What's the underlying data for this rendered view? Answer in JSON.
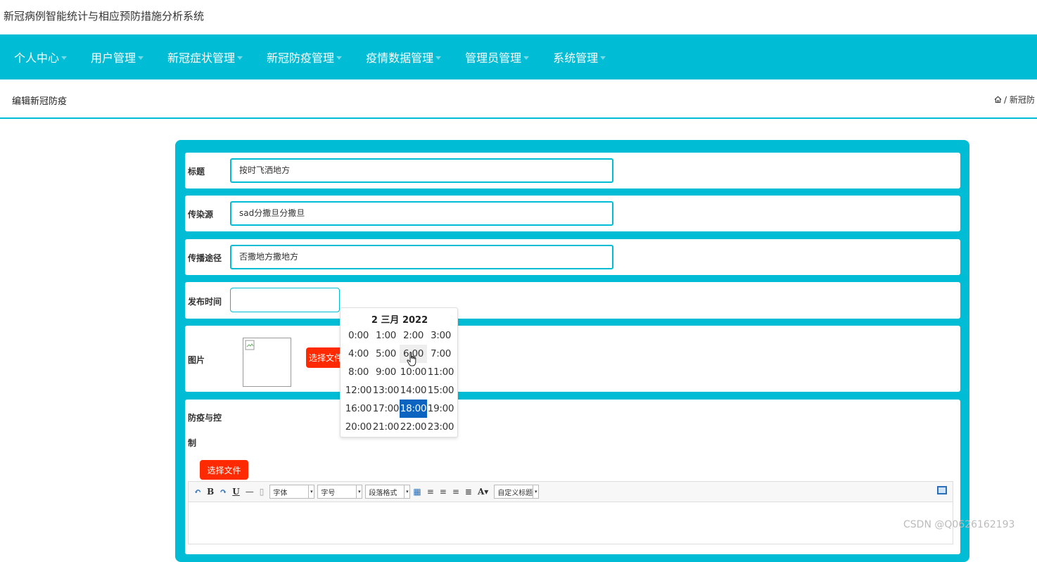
{
  "app": {
    "title": "新冠病例智能统计与相应预防措施分析系统"
  },
  "nav": {
    "items": [
      {
        "label": "个人中心"
      },
      {
        "label": "用户管理"
      },
      {
        "label": "新冠症状管理"
      },
      {
        "label": "新冠防疫管理"
      },
      {
        "label": "疫情数据管理"
      },
      {
        "label": "管理员管理"
      },
      {
        "label": "系统管理"
      }
    ]
  },
  "header": {
    "page_title": "编辑新冠防疫",
    "breadcrumb": "/ 新冠防"
  },
  "form": {
    "title_label": "标题",
    "title_value": "按时飞洒地方",
    "source_label": "传染源",
    "source_value": "sad分撒旦分撒旦",
    "route_label": "传播途径",
    "route_value": "否撒地方撒地方",
    "time_label": "发布时间",
    "time_value": "",
    "image_label": "图片",
    "image_button": "选择文件",
    "control_label_1": "防疫与控",
    "control_label_2": "制",
    "control_button": "选择文件"
  },
  "editor": {
    "font_select": "字体",
    "size_select": "字号",
    "para_select": "段落格式",
    "custom_select": "自定义标题"
  },
  "datepicker": {
    "header": "2 三月 2022",
    "hours": [
      "0:00",
      "1:00",
      "2:00",
      "3:00",
      "4:00",
      "5:00",
      "6:00",
      "7:00",
      "8:00",
      "9:00",
      "10:00",
      "11:00",
      "12:00",
      "13:00",
      "14:00",
      "15:00",
      "16:00",
      "17:00",
      "18:00",
      "19:00",
      "20:00",
      "21:00",
      "22:00",
      "23:00"
    ],
    "selected": "18:00",
    "hovered": "6:00"
  },
  "watermark": "CSDN @Q0626162193",
  "colors": {
    "accent": "#00bcd4",
    "button_red": "#ff2a00",
    "selected_blue": "#0b64c0"
  }
}
